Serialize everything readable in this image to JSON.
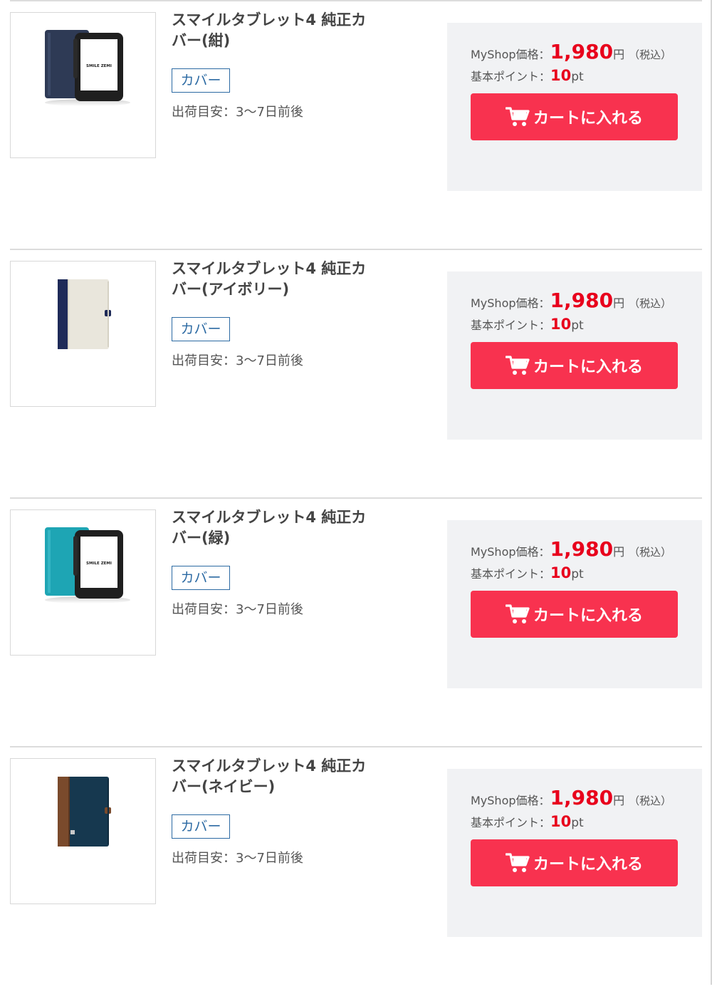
{
  "products": [
    {
      "name": "スマイルタブレット4 純正カバー(紺)",
      "name_line1": "スマイルタブレット4 純正カ",
      "name_line2": "バー(紺)",
      "category_tag": "カバー",
      "shipping": "出荷目安：3～7日前後",
      "price_label": "MyShop価格：",
      "price": "1,980",
      "price_unit": "円",
      "tax_note": "（税込）",
      "points_label": "基本ポイント：",
      "points": "10",
      "points_unit": "pt",
      "cart_button": "カートに入れる",
      "device_logo": "SMILE ZEMI",
      "cover_color": "#2e3a55"
    },
    {
      "name": "スマイルタブレット4 純正カバー(アイボリー)",
      "name_line1": "スマイルタブレット4 純正カ",
      "name_line2": "バー(アイボリー)",
      "category_tag": "カバー",
      "shipping": "出荷目安：3～7日前後",
      "price_label": "MyShop価格：",
      "price": "1,980",
      "price_unit": "円",
      "tax_note": "（税込）",
      "points_label": "基本ポイント：",
      "points": "10",
      "points_unit": "pt",
      "cart_button": "カートに入れる",
      "cover_color": "#e9e6dc"
    },
    {
      "name": "スマイルタブレット4 純正カバー(緑)",
      "name_line1": "スマイルタブレット4 純正カ",
      "name_line2": "バー(緑)",
      "category_tag": "カバー",
      "shipping": "出荷目安：3～7日前後",
      "price_label": "MyShop価格：",
      "price": "1,980",
      "price_unit": "円",
      "tax_note": "（税込）",
      "points_label": "基本ポイント：",
      "points": "10",
      "points_unit": "pt",
      "cart_button": "カートに入れる",
      "device_logo": "SMILE ZEMI",
      "cover_color": "#1ea5b4"
    },
    {
      "name": "スマイルタブレット4 純正カバー(ネイビー)",
      "name_line1": "スマイルタブレット4 純正カ",
      "name_line2": "バー(ネイビー)",
      "category_tag": "カバー",
      "shipping": "出荷目安：3～7日前後",
      "price_label": "MyShop価格：",
      "price": "1,980",
      "price_unit": "円",
      "tax_note": "（税込）",
      "points_label": "基本ポイント：",
      "points": "10",
      "points_unit": "pt",
      "cart_button": "カートに入れる",
      "cover_color": "#16384f"
    }
  ],
  "colors": {
    "price_red": "#e8001c",
    "cart_button": "#f8324f",
    "price_box_bg": "#f1f2f4",
    "tag_blue": "#2c6aa3"
  },
  "icons": {
    "cart": "shopping-cart-icon"
  }
}
